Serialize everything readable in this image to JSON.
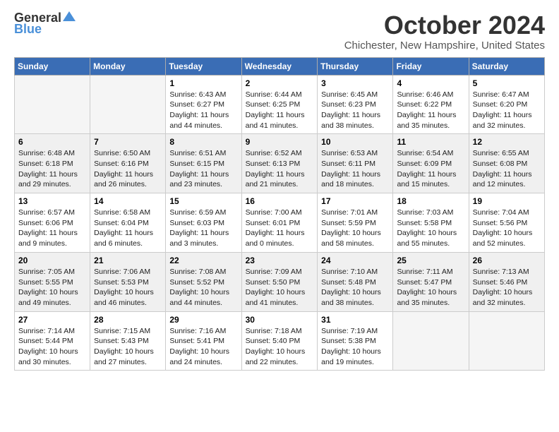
{
  "header": {
    "logo_general": "General",
    "logo_blue": "Blue",
    "title": "October 2024",
    "location": "Chichester, New Hampshire, United States"
  },
  "days_of_week": [
    "Sunday",
    "Monday",
    "Tuesday",
    "Wednesday",
    "Thursday",
    "Friday",
    "Saturday"
  ],
  "weeks": [
    [
      {
        "day": "",
        "sunrise": "",
        "sunset": "",
        "daylight": "",
        "empty": true
      },
      {
        "day": "",
        "sunrise": "",
        "sunset": "",
        "daylight": "",
        "empty": true
      },
      {
        "day": "1",
        "sunrise": "Sunrise: 6:43 AM",
        "sunset": "Sunset: 6:27 PM",
        "daylight": "Daylight: 11 hours and 44 minutes."
      },
      {
        "day": "2",
        "sunrise": "Sunrise: 6:44 AM",
        "sunset": "Sunset: 6:25 PM",
        "daylight": "Daylight: 11 hours and 41 minutes."
      },
      {
        "day": "3",
        "sunrise": "Sunrise: 6:45 AM",
        "sunset": "Sunset: 6:23 PM",
        "daylight": "Daylight: 11 hours and 38 minutes."
      },
      {
        "day": "4",
        "sunrise": "Sunrise: 6:46 AM",
        "sunset": "Sunset: 6:22 PM",
        "daylight": "Daylight: 11 hours and 35 minutes."
      },
      {
        "day": "5",
        "sunrise": "Sunrise: 6:47 AM",
        "sunset": "Sunset: 6:20 PM",
        "daylight": "Daylight: 11 hours and 32 minutes."
      }
    ],
    [
      {
        "day": "6",
        "sunrise": "Sunrise: 6:48 AM",
        "sunset": "Sunset: 6:18 PM",
        "daylight": "Daylight: 11 hours and 29 minutes."
      },
      {
        "day": "7",
        "sunrise": "Sunrise: 6:50 AM",
        "sunset": "Sunset: 6:16 PM",
        "daylight": "Daylight: 11 hours and 26 minutes."
      },
      {
        "day": "8",
        "sunrise": "Sunrise: 6:51 AM",
        "sunset": "Sunset: 6:15 PM",
        "daylight": "Daylight: 11 hours and 23 minutes."
      },
      {
        "day": "9",
        "sunrise": "Sunrise: 6:52 AM",
        "sunset": "Sunset: 6:13 PM",
        "daylight": "Daylight: 11 hours and 21 minutes."
      },
      {
        "day": "10",
        "sunrise": "Sunrise: 6:53 AM",
        "sunset": "Sunset: 6:11 PM",
        "daylight": "Daylight: 11 hours and 18 minutes."
      },
      {
        "day": "11",
        "sunrise": "Sunrise: 6:54 AM",
        "sunset": "Sunset: 6:09 PM",
        "daylight": "Daylight: 11 hours and 15 minutes."
      },
      {
        "day": "12",
        "sunrise": "Sunrise: 6:55 AM",
        "sunset": "Sunset: 6:08 PM",
        "daylight": "Daylight: 11 hours and 12 minutes."
      }
    ],
    [
      {
        "day": "13",
        "sunrise": "Sunrise: 6:57 AM",
        "sunset": "Sunset: 6:06 PM",
        "daylight": "Daylight: 11 hours and 9 minutes."
      },
      {
        "day": "14",
        "sunrise": "Sunrise: 6:58 AM",
        "sunset": "Sunset: 6:04 PM",
        "daylight": "Daylight: 11 hours and 6 minutes."
      },
      {
        "day": "15",
        "sunrise": "Sunrise: 6:59 AM",
        "sunset": "Sunset: 6:03 PM",
        "daylight": "Daylight: 11 hours and 3 minutes."
      },
      {
        "day": "16",
        "sunrise": "Sunrise: 7:00 AM",
        "sunset": "Sunset: 6:01 PM",
        "daylight": "Daylight: 11 hours and 0 minutes."
      },
      {
        "day": "17",
        "sunrise": "Sunrise: 7:01 AM",
        "sunset": "Sunset: 5:59 PM",
        "daylight": "Daylight: 10 hours and 58 minutes."
      },
      {
        "day": "18",
        "sunrise": "Sunrise: 7:03 AM",
        "sunset": "Sunset: 5:58 PM",
        "daylight": "Daylight: 10 hours and 55 minutes."
      },
      {
        "day": "19",
        "sunrise": "Sunrise: 7:04 AM",
        "sunset": "Sunset: 5:56 PM",
        "daylight": "Daylight: 10 hours and 52 minutes."
      }
    ],
    [
      {
        "day": "20",
        "sunrise": "Sunrise: 7:05 AM",
        "sunset": "Sunset: 5:55 PM",
        "daylight": "Daylight: 10 hours and 49 minutes."
      },
      {
        "day": "21",
        "sunrise": "Sunrise: 7:06 AM",
        "sunset": "Sunset: 5:53 PM",
        "daylight": "Daylight: 10 hours and 46 minutes."
      },
      {
        "day": "22",
        "sunrise": "Sunrise: 7:08 AM",
        "sunset": "Sunset: 5:52 PM",
        "daylight": "Daylight: 10 hours and 44 minutes."
      },
      {
        "day": "23",
        "sunrise": "Sunrise: 7:09 AM",
        "sunset": "Sunset: 5:50 PM",
        "daylight": "Daylight: 10 hours and 41 minutes."
      },
      {
        "day": "24",
        "sunrise": "Sunrise: 7:10 AM",
        "sunset": "Sunset: 5:48 PM",
        "daylight": "Daylight: 10 hours and 38 minutes."
      },
      {
        "day": "25",
        "sunrise": "Sunrise: 7:11 AM",
        "sunset": "Sunset: 5:47 PM",
        "daylight": "Daylight: 10 hours and 35 minutes."
      },
      {
        "day": "26",
        "sunrise": "Sunrise: 7:13 AM",
        "sunset": "Sunset: 5:46 PM",
        "daylight": "Daylight: 10 hours and 32 minutes."
      }
    ],
    [
      {
        "day": "27",
        "sunrise": "Sunrise: 7:14 AM",
        "sunset": "Sunset: 5:44 PM",
        "daylight": "Daylight: 10 hours and 30 minutes."
      },
      {
        "day": "28",
        "sunrise": "Sunrise: 7:15 AM",
        "sunset": "Sunset: 5:43 PM",
        "daylight": "Daylight: 10 hours and 27 minutes."
      },
      {
        "day": "29",
        "sunrise": "Sunrise: 7:16 AM",
        "sunset": "Sunset: 5:41 PM",
        "daylight": "Daylight: 10 hours and 24 minutes."
      },
      {
        "day": "30",
        "sunrise": "Sunrise: 7:18 AM",
        "sunset": "Sunset: 5:40 PM",
        "daylight": "Daylight: 10 hours and 22 minutes."
      },
      {
        "day": "31",
        "sunrise": "Sunrise: 7:19 AM",
        "sunset": "Sunset: 5:38 PM",
        "daylight": "Daylight: 10 hours and 19 minutes."
      },
      {
        "day": "",
        "sunrise": "",
        "sunset": "",
        "daylight": "",
        "empty": true
      },
      {
        "day": "",
        "sunrise": "",
        "sunset": "",
        "daylight": "",
        "empty": true
      }
    ]
  ]
}
